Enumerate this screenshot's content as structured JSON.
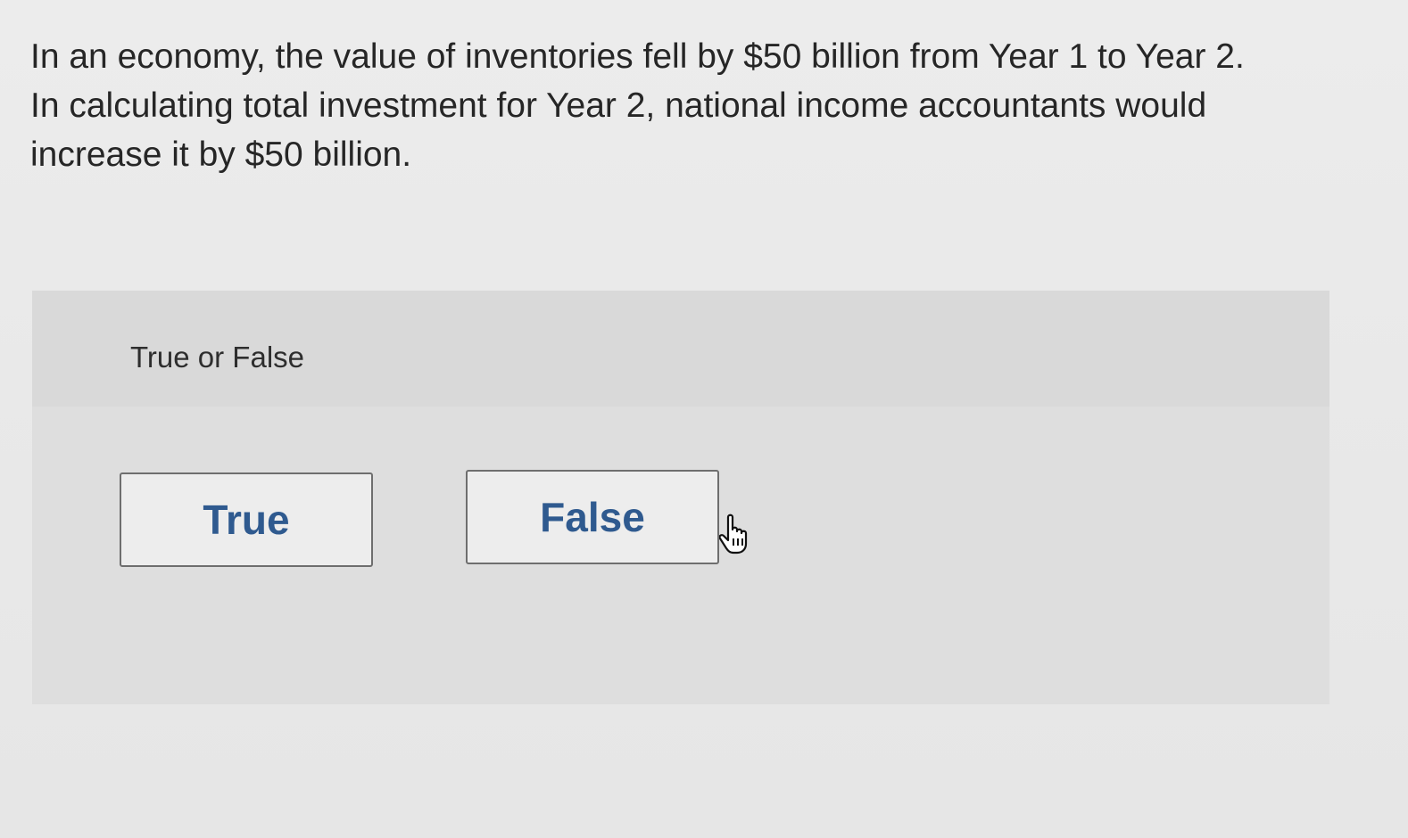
{
  "question": {
    "lines": [
      "In an economy, the value of inventories fell by $50 billion from Year 1 to Year 2.",
      "In calculating total investment for Year 2, national income accountants would",
      "increase it by $50 billion."
    ]
  },
  "answer_panel": {
    "prompt": "True or False",
    "choices": [
      {
        "label": "True"
      },
      {
        "label": "False"
      }
    ]
  },
  "cursor": {
    "icon": "hand-pointer-icon"
  },
  "colors": {
    "button_text": "#2f5a8f",
    "button_border": "#6e6e6e",
    "panel_bg": "#dedede",
    "page_bg": "#ebebeb"
  }
}
